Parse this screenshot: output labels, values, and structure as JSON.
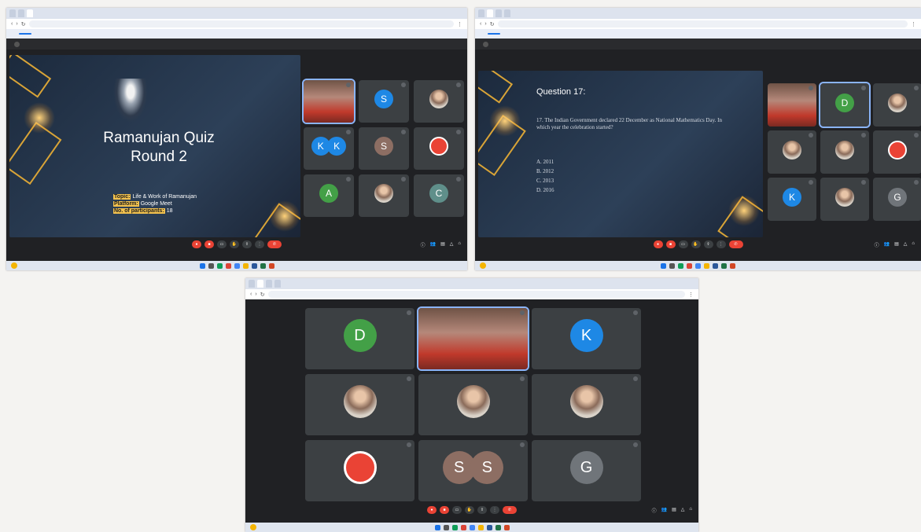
{
  "colors": {
    "meet_bg": "#202124",
    "tile_bg": "#3c4043",
    "end_call_red": "#ea4335",
    "chrome_blue": "#1a73e8",
    "avatar_green": "#43a047",
    "avatar_blue": "#1e88e5",
    "avatar_brown": "#8d6e63",
    "avatar_teal": "#5f8f8a",
    "avatar_gray": "#70757a",
    "slide_gold": "#d9a437"
  },
  "shot1": {
    "slide": {
      "title_line1": "Ramanujan Quiz",
      "title_line2": "Round 2",
      "topic_label": "Topic:",
      "topic_value": "Life & Work of Ramanujan",
      "platform_label": "Platform:",
      "platform_value": "Google Meet",
      "participants_label": "No. of participants:",
      "participants_value": "18"
    },
    "tiles": [
      {
        "type": "video"
      },
      {
        "type": "letter",
        "letter": "S",
        "color": "#1e88e5"
      },
      {
        "type": "photo"
      },
      {
        "type": "letters",
        "letters": [
          "K",
          "K"
        ],
        "color": "#1e88e5"
      },
      {
        "type": "letter",
        "letter": "S",
        "color": "#8d6e63"
      },
      {
        "type": "photo-red"
      },
      {
        "type": "letter",
        "letter": "A",
        "color": "#43a047"
      },
      {
        "type": "photo"
      },
      {
        "type": "letter",
        "letter": "C",
        "color": "#5f8f8a"
      }
    ]
  },
  "shot2": {
    "question_title": "Question 17:",
    "question_text": "17. The Indian Government declared 22 December as National Mathematics Day. In which year the celebration started?",
    "options": [
      "A. 2011",
      "B. 2012",
      "C. 2013",
      "D. 2016"
    ],
    "tiles": [
      {
        "type": "video"
      },
      {
        "type": "letter",
        "letter": "D",
        "color": "#43a047"
      },
      {
        "type": "photo"
      },
      {
        "type": "photo"
      },
      {
        "type": "photo"
      },
      {
        "type": "photo-red"
      },
      {
        "type": "letter",
        "letter": "K",
        "color": "#1e88e5"
      },
      {
        "type": "photo"
      },
      {
        "type": "letter",
        "letter": "G",
        "color": "#70757a"
      }
    ]
  },
  "shot3": {
    "tiles": [
      {
        "type": "letter",
        "letter": "D",
        "color": "#43a047"
      },
      {
        "type": "video"
      },
      {
        "type": "letter",
        "letter": "K",
        "color": "#1e88e5"
      },
      {
        "type": "photo"
      },
      {
        "type": "photo"
      },
      {
        "type": "photo"
      },
      {
        "type": "photo-red"
      },
      {
        "type": "letters",
        "letters": [
          "S",
          "S"
        ],
        "color": "#8d6e63"
      },
      {
        "type": "letter",
        "letter": "G",
        "color": "#70757a"
      }
    ]
  },
  "icons": [
    "mic-icon",
    "camera-icon",
    "captions-icon",
    "raise-hand-icon",
    "present-icon",
    "more-icon",
    "end-call-icon",
    "info-icon",
    "people-icon",
    "chat-icon",
    "activities-icon",
    "lock-icon"
  ]
}
